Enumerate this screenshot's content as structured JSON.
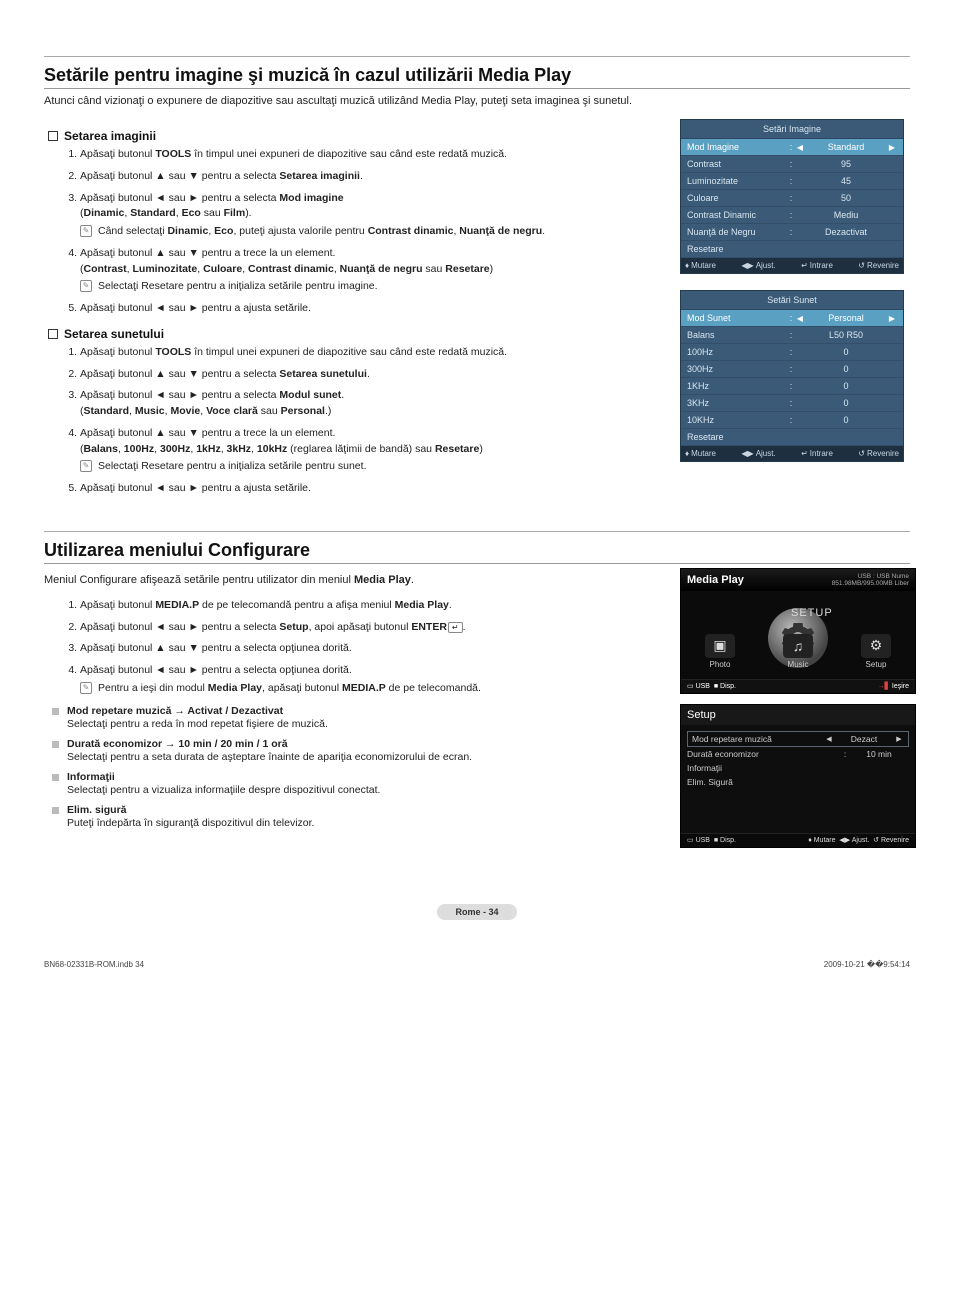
{
  "section1": {
    "title": "Setările pentru imagine şi muzică în cazul utilizării Media Play",
    "intro": "Atunci când vizionaţi o expunere de diapozitive sau ascultaţi muzică utilizând Media Play, puteţi seta imaginea şi sunetul.",
    "sub1": {
      "heading": "Setarea imaginii",
      "steps": {
        "1a": "Apăsaţi butonul ",
        "1b": "TOOLS",
        "1c": " în timpul unei expuneri de diapozitive sau când este redată muzică.",
        "2a": "Apăsaţi butonul ▲ sau ▼ pentru a selecta ",
        "2b": "Setarea imaginii",
        "2c": ".",
        "3a": "Apăsaţi butonul ◄ sau ► pentru a selecta ",
        "3b": "Mod imagine",
        "3c": "(",
        "3d": "Dinamic",
        "3e": ", ",
        "3f": "Standard",
        "3g": ", ",
        "3h": "Eco",
        "3i": " sau ",
        "3j": "Film",
        "3k": ").",
        "3n1": "Când selectaţi ",
        "3n2": "Dinamic",
        "3n3": ", ",
        "3n4": "Eco",
        "3n5": ", puteţi ajusta valorile pentru ",
        "3n6": "Contrast dinamic",
        "3n7": ", ",
        "3n8": "Nuanţă de negru",
        "3n9": ".",
        "4a": "Apăsaţi butonul ▲ sau ▼ pentru a trece la un element.",
        "4b": "(",
        "4c": "Contrast",
        "4d": ", ",
        "4e": "Luminozitate",
        "4f": ", ",
        "4g": "Culoare",
        "4h": ", ",
        "4i": "Contrast dinamic",
        "4j": ", ",
        "4k": "Nuanţă de negru",
        "4l": " sau ",
        "4m": "Resetare",
        "4n": ")",
        "4note": "Selectaţi Resetare pentru a iniţializa setările pentru imagine.",
        "5": "Apăsaţi butonul ◄ sau ► pentru a ajusta setările."
      }
    },
    "sub2": {
      "heading": "Setarea sunetului",
      "steps": {
        "1a": "Apăsaţi butonul ",
        "1b": "TOOLS",
        "1c": " în timpul unei expuneri de diapozitive sau când este redată muzică.",
        "2a": "Apăsaţi butonul ▲ sau ▼ pentru a selecta ",
        "2b": "Setarea sunetului",
        "2c": ".",
        "3a": "Apăsaţi butonul ◄ sau ► pentru a selecta ",
        "3b": "Modul sunet",
        "3c": ".",
        "3d": "(",
        "3e": "Standard",
        "3f": ", ",
        "3g": "Music",
        "3h": ", ",
        "3i": "Movie",
        "3j": ", ",
        "3k": "Voce clară",
        "3l": " sau ",
        "3m": "Personal",
        "3n": ".)",
        "4a": "Apăsaţi butonul ▲ sau ▼ pentru a trece la un element.",
        "4b": "(",
        "4c": "Balans",
        "4d": ", ",
        "4e": "100Hz",
        "4f": ", ",
        "4g": "300Hz",
        "4h": ", ",
        "4i": "1kHz",
        "4j": ", ",
        "4k": "3kHz",
        "4l": ", ",
        "4m": "10kHz",
        "4n": " (reglarea lăţimii de bandă) sau ",
        "4o": "Resetare",
        "4p": ")",
        "4note": "Selectaţi Resetare pentru a iniţializa setările pentru sunet.",
        "5": "Apăsaţi butonul ◄ sau ► pentru a ajusta setările."
      }
    },
    "osd_image": {
      "title": "Setări Imagine",
      "rows": [
        {
          "label": "Mod Imagine",
          "val": "Standard",
          "hl": true,
          "arrows": true
        },
        {
          "label": "Contrast",
          "val": "95"
        },
        {
          "label": "Luminozitate",
          "val": "45"
        },
        {
          "label": "Culoare",
          "val": "50"
        },
        {
          "label": "Contrast Dinamic",
          "val": "Mediu"
        },
        {
          "label": "Nuanţă de Negru",
          "val": "Dezactivat"
        },
        {
          "label": "Resetare",
          "val": ""
        }
      ],
      "nav": {
        "a": "Mutare",
        "b": "Ajust.",
        "c": "Intrare",
        "d": "Revenire"
      }
    },
    "osd_sound": {
      "title": "Setări Sunet",
      "rows": [
        {
          "label": "Mod Sunet",
          "val": "Personal",
          "hl": true,
          "arrows": true
        },
        {
          "label": "Balans",
          "val": "L50 R50"
        },
        {
          "label": "100Hz",
          "val": "0"
        },
        {
          "label": "300Hz",
          "val": "0"
        },
        {
          "label": "1KHz",
          "val": "0"
        },
        {
          "label": "3KHz",
          "val": "0"
        },
        {
          "label": "10KHz",
          "val": "0"
        },
        {
          "label": "Resetare",
          "val": ""
        }
      ],
      "nav": {
        "a": "Mutare",
        "b": "Ajust.",
        "c": "Intrare",
        "d": "Revenire"
      }
    }
  },
  "section2": {
    "title": "Utilizarea meniului Configurare",
    "intro1": "Meniul Configurare afişează setările pentru utilizator din meniul ",
    "intro2": "Media Play",
    "intro3": ".",
    "steps": {
      "1a": "Apăsaţi butonul ",
      "1b": "MEDIA.P",
      "1c": " de pe telecomandă pentru a afişa meniul ",
      "1d": "Media Play",
      "1e": ".",
      "2a": "Apăsaţi butonul ◄ sau ► pentru a selecta ",
      "2b": "Setup",
      "2c": ", apoi apăsaţi butonul ",
      "2d": "ENTER",
      "2e": ".",
      "3": "Apăsaţi butonul ▲ sau ▼ pentru a selecta opţiunea dorită.",
      "4": "Apăsaţi butonul ◄ sau ► pentru a selecta opţiunea dorită.",
      "note1": "Pentru a ieşi din modul ",
      "note2": "Media Play",
      "note3": ", apăsaţi butonul ",
      "note4": "MEDIA.P",
      "note5": " de pe telecomandă."
    },
    "bullets": [
      {
        "title": "Mod repetare muzică → Activat / Dezactivat",
        "desc": "Selectaţi pentru a reda în mod repetat fişiere de muzică."
      },
      {
        "title": "Durată economizor → 10 min / 20 min / 1 oră",
        "desc": "Selectaţi pentru a seta durata de aşteptare înainte de apariţia economizorului de ecran."
      },
      {
        "title": "Informaţii",
        "desc": "Selectaţi pentru a vizualiza informaţiile despre dispozitivul conectat."
      },
      {
        "title": "Elim. sigură",
        "desc": "Puteţi îndepărta în siguranţă dispozitivul din televizor."
      }
    ],
    "mp": {
      "title": "Media Play",
      "usb1": "USB : USB Nume",
      "usb2": "851.98MB/995.00MB Liber",
      "setup_big": "SETUP",
      "items": {
        "photo": "Photo",
        "music": "Music",
        "setup": "Setup"
      },
      "footer_left": "USB",
      "footer_disp": "Disp.",
      "footer_right": "Ieşire"
    },
    "setup_panel": {
      "title": "Setup",
      "rows": [
        {
          "label": "Mod repetare muzică",
          "val": "Dezact",
          "first": true,
          "arrows": true
        },
        {
          "label": "Durată economizor",
          "val": "10 min"
        },
        {
          "label": "Informaţii",
          "val": ""
        },
        {
          "label": "Elim. Sigură",
          "val": ""
        }
      ],
      "footer": {
        "usb": "USB",
        "disp": "Disp.",
        "a": "Mutare",
        "b": "Ajust.",
        "c": "Revenire"
      }
    }
  },
  "page_tag": "Rome - 34",
  "doc_footer": {
    "left": "BN68-02331B-ROM.indb   34",
    "right": "2009-10-21   ��9:54:14"
  }
}
